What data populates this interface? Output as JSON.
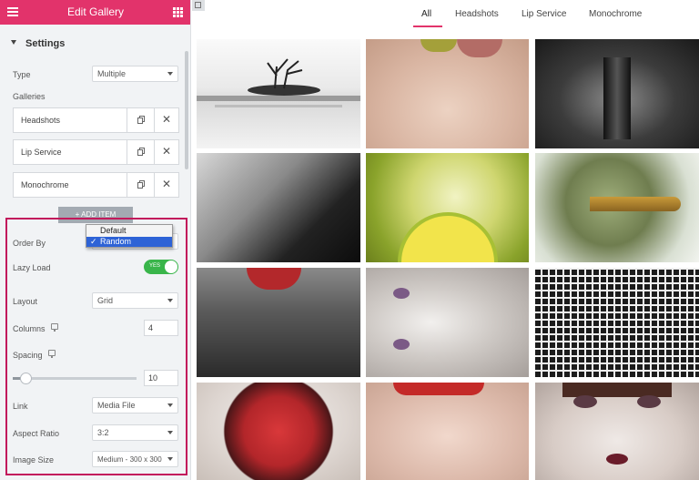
{
  "panel": {
    "title": "Edit Gallery",
    "section": "Settings",
    "type": {
      "label": "Type",
      "value": "Multiple"
    },
    "galleries_label": "Galleries",
    "galleries": [
      {
        "name": "Headshots"
      },
      {
        "name": "Lip Service"
      },
      {
        "name": "Monochrome"
      }
    ],
    "add_item": "+ ADD ITEM",
    "order_by": {
      "label": "Order By",
      "options": [
        "Default",
        "Random"
      ],
      "selected": "Random",
      "check": "✓"
    },
    "lazy_load": {
      "label": "Lazy Load",
      "state": "YES"
    },
    "layout": {
      "label": "Layout",
      "value": "Grid"
    },
    "columns": {
      "label": "Columns",
      "value": "4"
    },
    "spacing": {
      "label": "Spacing",
      "value": "10",
      "max": 100
    },
    "link": {
      "label": "Link",
      "value": "Media File"
    },
    "aspect_ratio": {
      "label": "Aspect Ratio",
      "value": "3:2"
    },
    "image_size": {
      "label": "Image Size",
      "value": "Medium - 300 x 300"
    }
  },
  "preview": {
    "filters": [
      "All",
      "Headshots",
      "Lip Service",
      "Monochrome"
    ],
    "active_filter": "All"
  },
  "colors": {
    "brand": "#e2336b",
    "highlight": "#c2185b",
    "toggle_on": "#39b54a",
    "selection": "#2e63d6"
  },
  "icons": [
    "menu-icon",
    "grid-icon",
    "caret-down-icon",
    "duplicate-icon",
    "close-icon",
    "desktop-icon",
    "chevron-down-icon",
    "checkmark-icon",
    "collapse-panel-icon"
  ]
}
